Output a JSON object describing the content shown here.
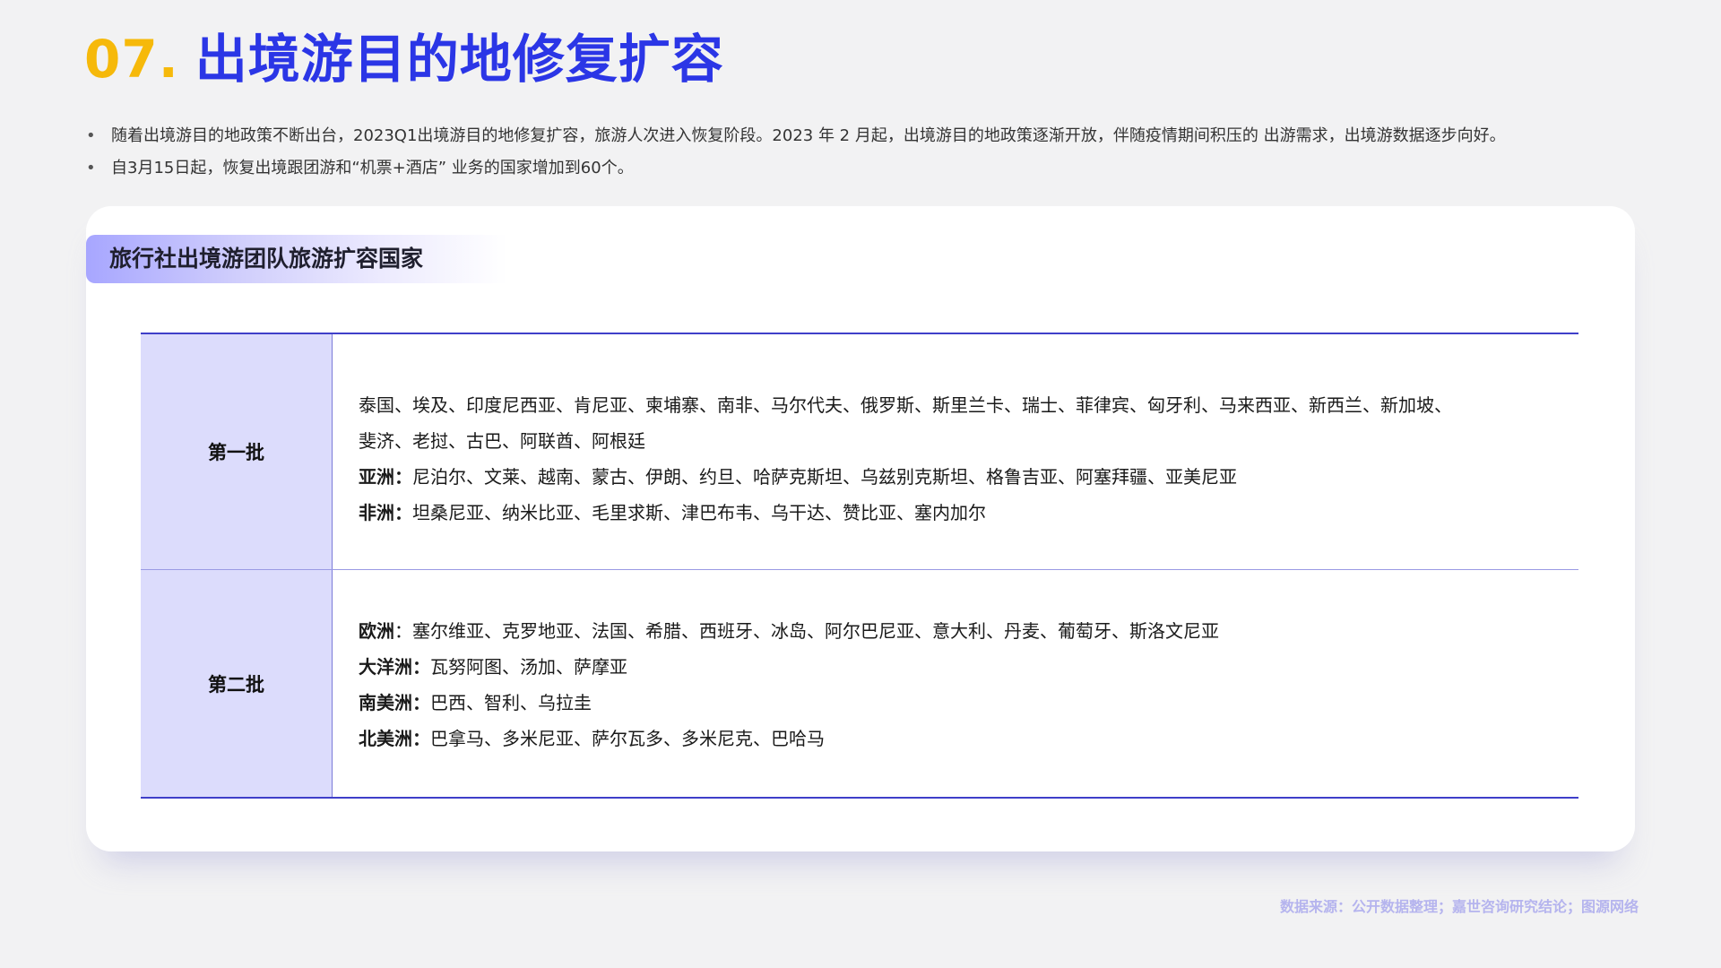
{
  "title": {
    "number": "07.",
    "text": "出境游目的地修复扩容"
  },
  "bullets": [
    "随着出境游目的地政策不断出台，2023Q1出境游目的地修复扩容，旅游人次进入恢复阶段。2023 年 2 月起，出境游目的地政策逐渐开放，伴随疫情期间积压的 出游需求，出境游数据逐步向好。",
    "自3月15日起，恢复出境跟团游和“机票+酒店” 业务的国家增加到60个。"
  ],
  "bullet_marker": "•",
  "card": {
    "tag": "旅行社出境游团队旅游扩容国家",
    "rows": [
      {
        "head": "第一批",
        "lines": [
          {
            "label": "",
            "text": "泰国、埃及、印度尼西亚、肯尼亚、柬埔寨、南非、马尔代夫、俄罗斯、斯里兰卡、瑞士、菲律宾、匈牙利、马来西亚、新西兰、新加坡、"
          },
          {
            "label": "",
            "text": "斐济、老挝、古巴、阿联酋、阿根廷"
          },
          {
            "label": "亚洲：",
            "text": "尼泊尔、文莱、越南、蒙古、伊朗、约旦、哈萨克斯坦、乌兹别克斯坦、格鲁吉亚、阿塞拜疆、亚美尼亚"
          },
          {
            "label": "非洲：",
            "text": "坦桑尼亚、纳米比亚、毛里求斯、津巴布韦、乌干达、赞比亚、塞内加尔"
          }
        ]
      },
      {
        "head": "第二批",
        "lines": [
          {
            "label": "欧洲",
            "text": "：塞尔维亚、克罗地亚、法国、希腊、西班牙、冰岛、阿尔巴尼亚、意大利、丹麦、葡萄牙、斯洛文尼亚"
          },
          {
            "label": "大洋洲：",
            "text": "瓦努阿图、汤加、萨摩亚"
          },
          {
            "label": "南美洲：",
            "text": "巴西、智利、乌拉圭"
          },
          {
            "label": "北美洲：",
            "text": "巴拿马、多米尼亚、萨尔瓦多、多米尼克、巴哈马"
          }
        ]
      }
    ]
  },
  "source": "数据来源：公开数据整理；嘉世咨询研究结论；图源网络",
  "colors": {
    "accent_yellow": "#f6b90a",
    "accent_blue": "#2b36e6",
    "table_head_bg": "#dcdcfc"
  }
}
